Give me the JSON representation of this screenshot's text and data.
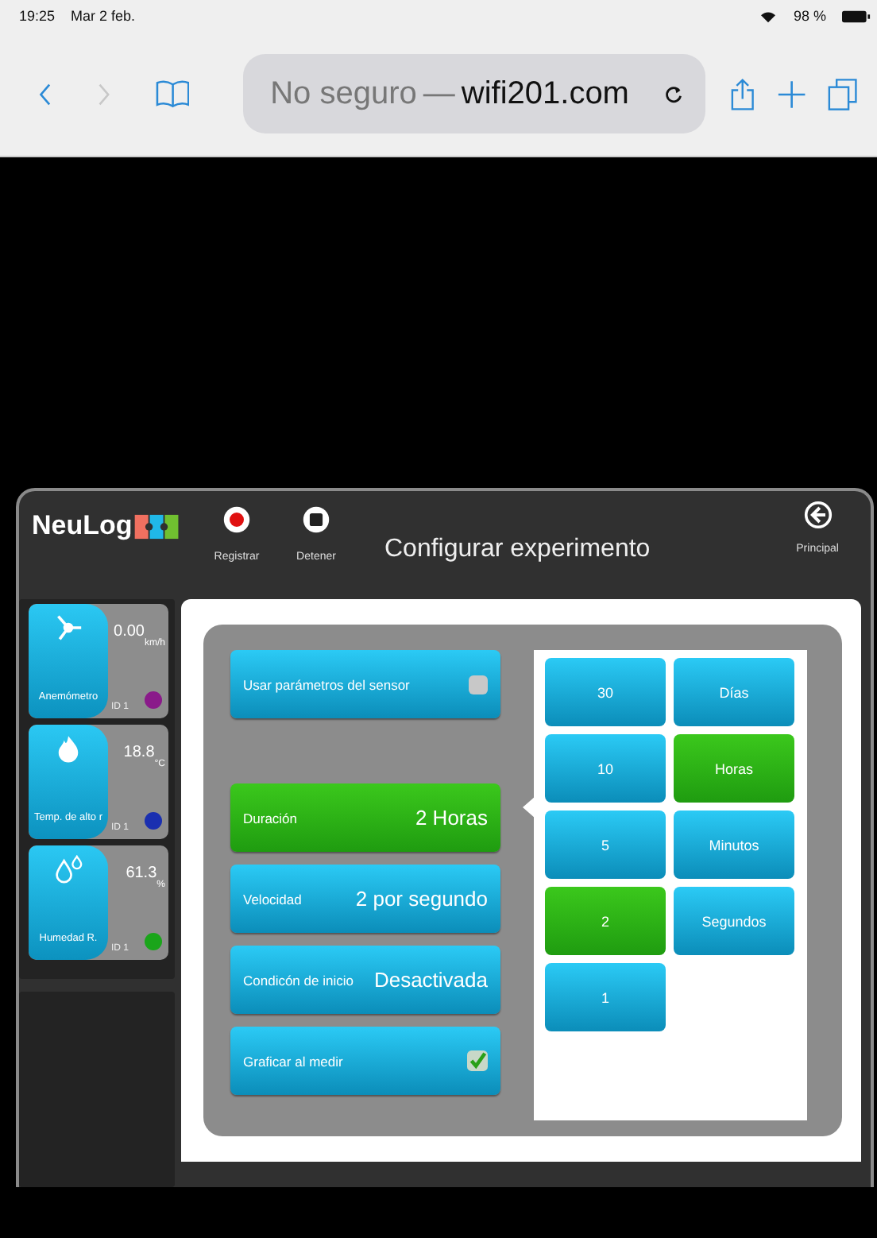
{
  "status_bar": {
    "time": "19:25",
    "date": "Mar 2 feb.",
    "battery": "98 %"
  },
  "browser": {
    "security": "No seguro",
    "separator": "—",
    "domain": "wifi201.com",
    "forward_disabled": true
  },
  "app": {
    "logo": "NeuLog",
    "title": "Configurar experimento",
    "toolbar": [
      {
        "kind": "record",
        "label": "Registrar"
      },
      {
        "kind": "stop",
        "label": "Detener"
      }
    ],
    "home": {
      "label": "Principal"
    },
    "sensors": [
      {
        "kind": "wind",
        "name": "Anemómetro",
        "value": "0.00",
        "unit": "km/h",
        "id": "ID 1",
        "color": "#8a1a8a"
      },
      {
        "kind": "flame",
        "name": "Temp. de alto r",
        "value": "18.8",
        "unit": "°C",
        "id": "ID 1",
        "color": "#1a2fb0"
      },
      {
        "kind": "drops",
        "name": "Humedad R.",
        "value": "61.3",
        "unit": "%",
        "id": "ID 1",
        "color": "#1aa51a"
      }
    ],
    "settings": [
      {
        "kind": "checkbox",
        "label": "Usar parámetros del sensor",
        "checked": false,
        "selected": false
      },
      {
        "kind": "value",
        "label": "Duración",
        "value": "2 Horas",
        "selected": true
      },
      {
        "kind": "value",
        "label": "Velocidad",
        "value": "2 por segundo",
        "selected": false
      },
      {
        "kind": "value",
        "label": "Condicón de inicio",
        "value": "Desactivada",
        "selected": false
      },
      {
        "kind": "checkbox",
        "label": "Graficar al medir",
        "checked": true,
        "selected": false
      }
    ],
    "amounts": [
      {
        "label": "30",
        "selected": false
      },
      {
        "label": "10",
        "selected": false
      },
      {
        "label": "5",
        "selected": false
      },
      {
        "label": "2",
        "selected": true
      },
      {
        "label": "1",
        "selected": false
      }
    ],
    "units": [
      {
        "label": "Días",
        "selected": false
      },
      {
        "label": "Horas",
        "selected": true
      },
      {
        "label": "Minutos",
        "selected": false
      },
      {
        "label": "Segundos",
        "selected": false
      }
    ]
  }
}
